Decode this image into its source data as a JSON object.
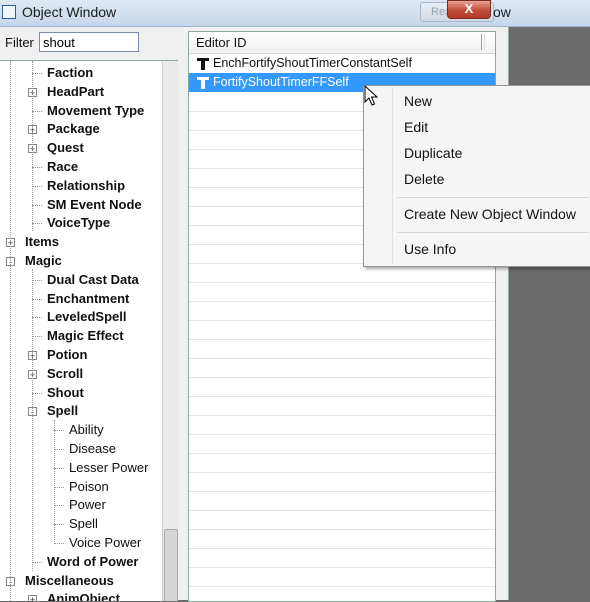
{
  "window": {
    "title": "Object Window",
    "right_title_fragment": "ow",
    "background_button_text": "Rea",
    "close_symbol": "X"
  },
  "filter": {
    "label": "Filter",
    "value": "shout"
  },
  "tree": {
    "items": [
      {
        "label": "Faction",
        "level": 2,
        "bold": true,
        "expander": ""
      },
      {
        "label": "HeadPart",
        "level": 2,
        "bold": true,
        "expander": "+"
      },
      {
        "label": "Movement Type",
        "level": 2,
        "bold": true,
        "expander": ""
      },
      {
        "label": "Package",
        "level": 2,
        "bold": true,
        "expander": "+"
      },
      {
        "label": "Quest",
        "level": 2,
        "bold": true,
        "expander": "+"
      },
      {
        "label": "Race",
        "level": 2,
        "bold": true,
        "expander": ""
      },
      {
        "label": "Relationship",
        "level": 2,
        "bold": true,
        "expander": ""
      },
      {
        "label": "SM Event Node",
        "level": 2,
        "bold": true,
        "expander": ""
      },
      {
        "label": "VoiceType",
        "level": 2,
        "bold": true,
        "expander": ""
      },
      {
        "label": "Items",
        "level": 1,
        "bold": true,
        "expander": "+"
      },
      {
        "label": "Magic",
        "level": 1,
        "bold": true,
        "expander": "-"
      },
      {
        "label": "Dual Cast Data",
        "level": 2,
        "bold": true,
        "expander": ""
      },
      {
        "label": "Enchantment",
        "level": 2,
        "bold": true,
        "expander": ""
      },
      {
        "label": "LeveledSpell",
        "level": 2,
        "bold": true,
        "expander": ""
      },
      {
        "label": "Magic Effect",
        "level": 2,
        "bold": true,
        "expander": ""
      },
      {
        "label": "Potion",
        "level": 2,
        "bold": true,
        "expander": "+"
      },
      {
        "label": "Scroll",
        "level": 2,
        "bold": true,
        "expander": "+"
      },
      {
        "label": "Shout",
        "level": 2,
        "bold": true,
        "expander": ""
      },
      {
        "label": "Spell",
        "level": 2,
        "bold": true,
        "expander": "-"
      },
      {
        "label": "Ability",
        "level": 3,
        "bold": false,
        "expander": ""
      },
      {
        "label": "Disease",
        "level": 3,
        "bold": false,
        "expander": ""
      },
      {
        "label": "Lesser Power",
        "level": 3,
        "bold": false,
        "expander": ""
      },
      {
        "label": "Poison",
        "level": 3,
        "bold": false,
        "expander": ""
      },
      {
        "label": "Power",
        "level": 3,
        "bold": false,
        "expander": ""
      },
      {
        "label": "Spell",
        "level": 3,
        "bold": false,
        "expander": ""
      },
      {
        "label": "Voice Power",
        "level": 3,
        "bold": false,
        "expander": ""
      },
      {
        "label": "Word of Power",
        "level": 2,
        "bold": true,
        "expander": ""
      },
      {
        "label": "Miscellaneous",
        "level": 1,
        "bold": true,
        "expander": "-"
      },
      {
        "label": "AnimObject",
        "level": 2,
        "bold": true,
        "expander": "+"
      }
    ]
  },
  "list": {
    "column_header": "Editor ID",
    "rows": [
      {
        "label": "EnchFortifyShoutTimerConstantSelf",
        "selected": false
      },
      {
        "label": "FortifyShoutTimerFFSelf",
        "selected": true
      }
    ],
    "selection_color": "#3399ff"
  },
  "context_menu": {
    "items": [
      "New",
      "Edit",
      "Duplicate",
      "Delete",
      "Create New Object Window",
      "Use Info"
    ]
  }
}
